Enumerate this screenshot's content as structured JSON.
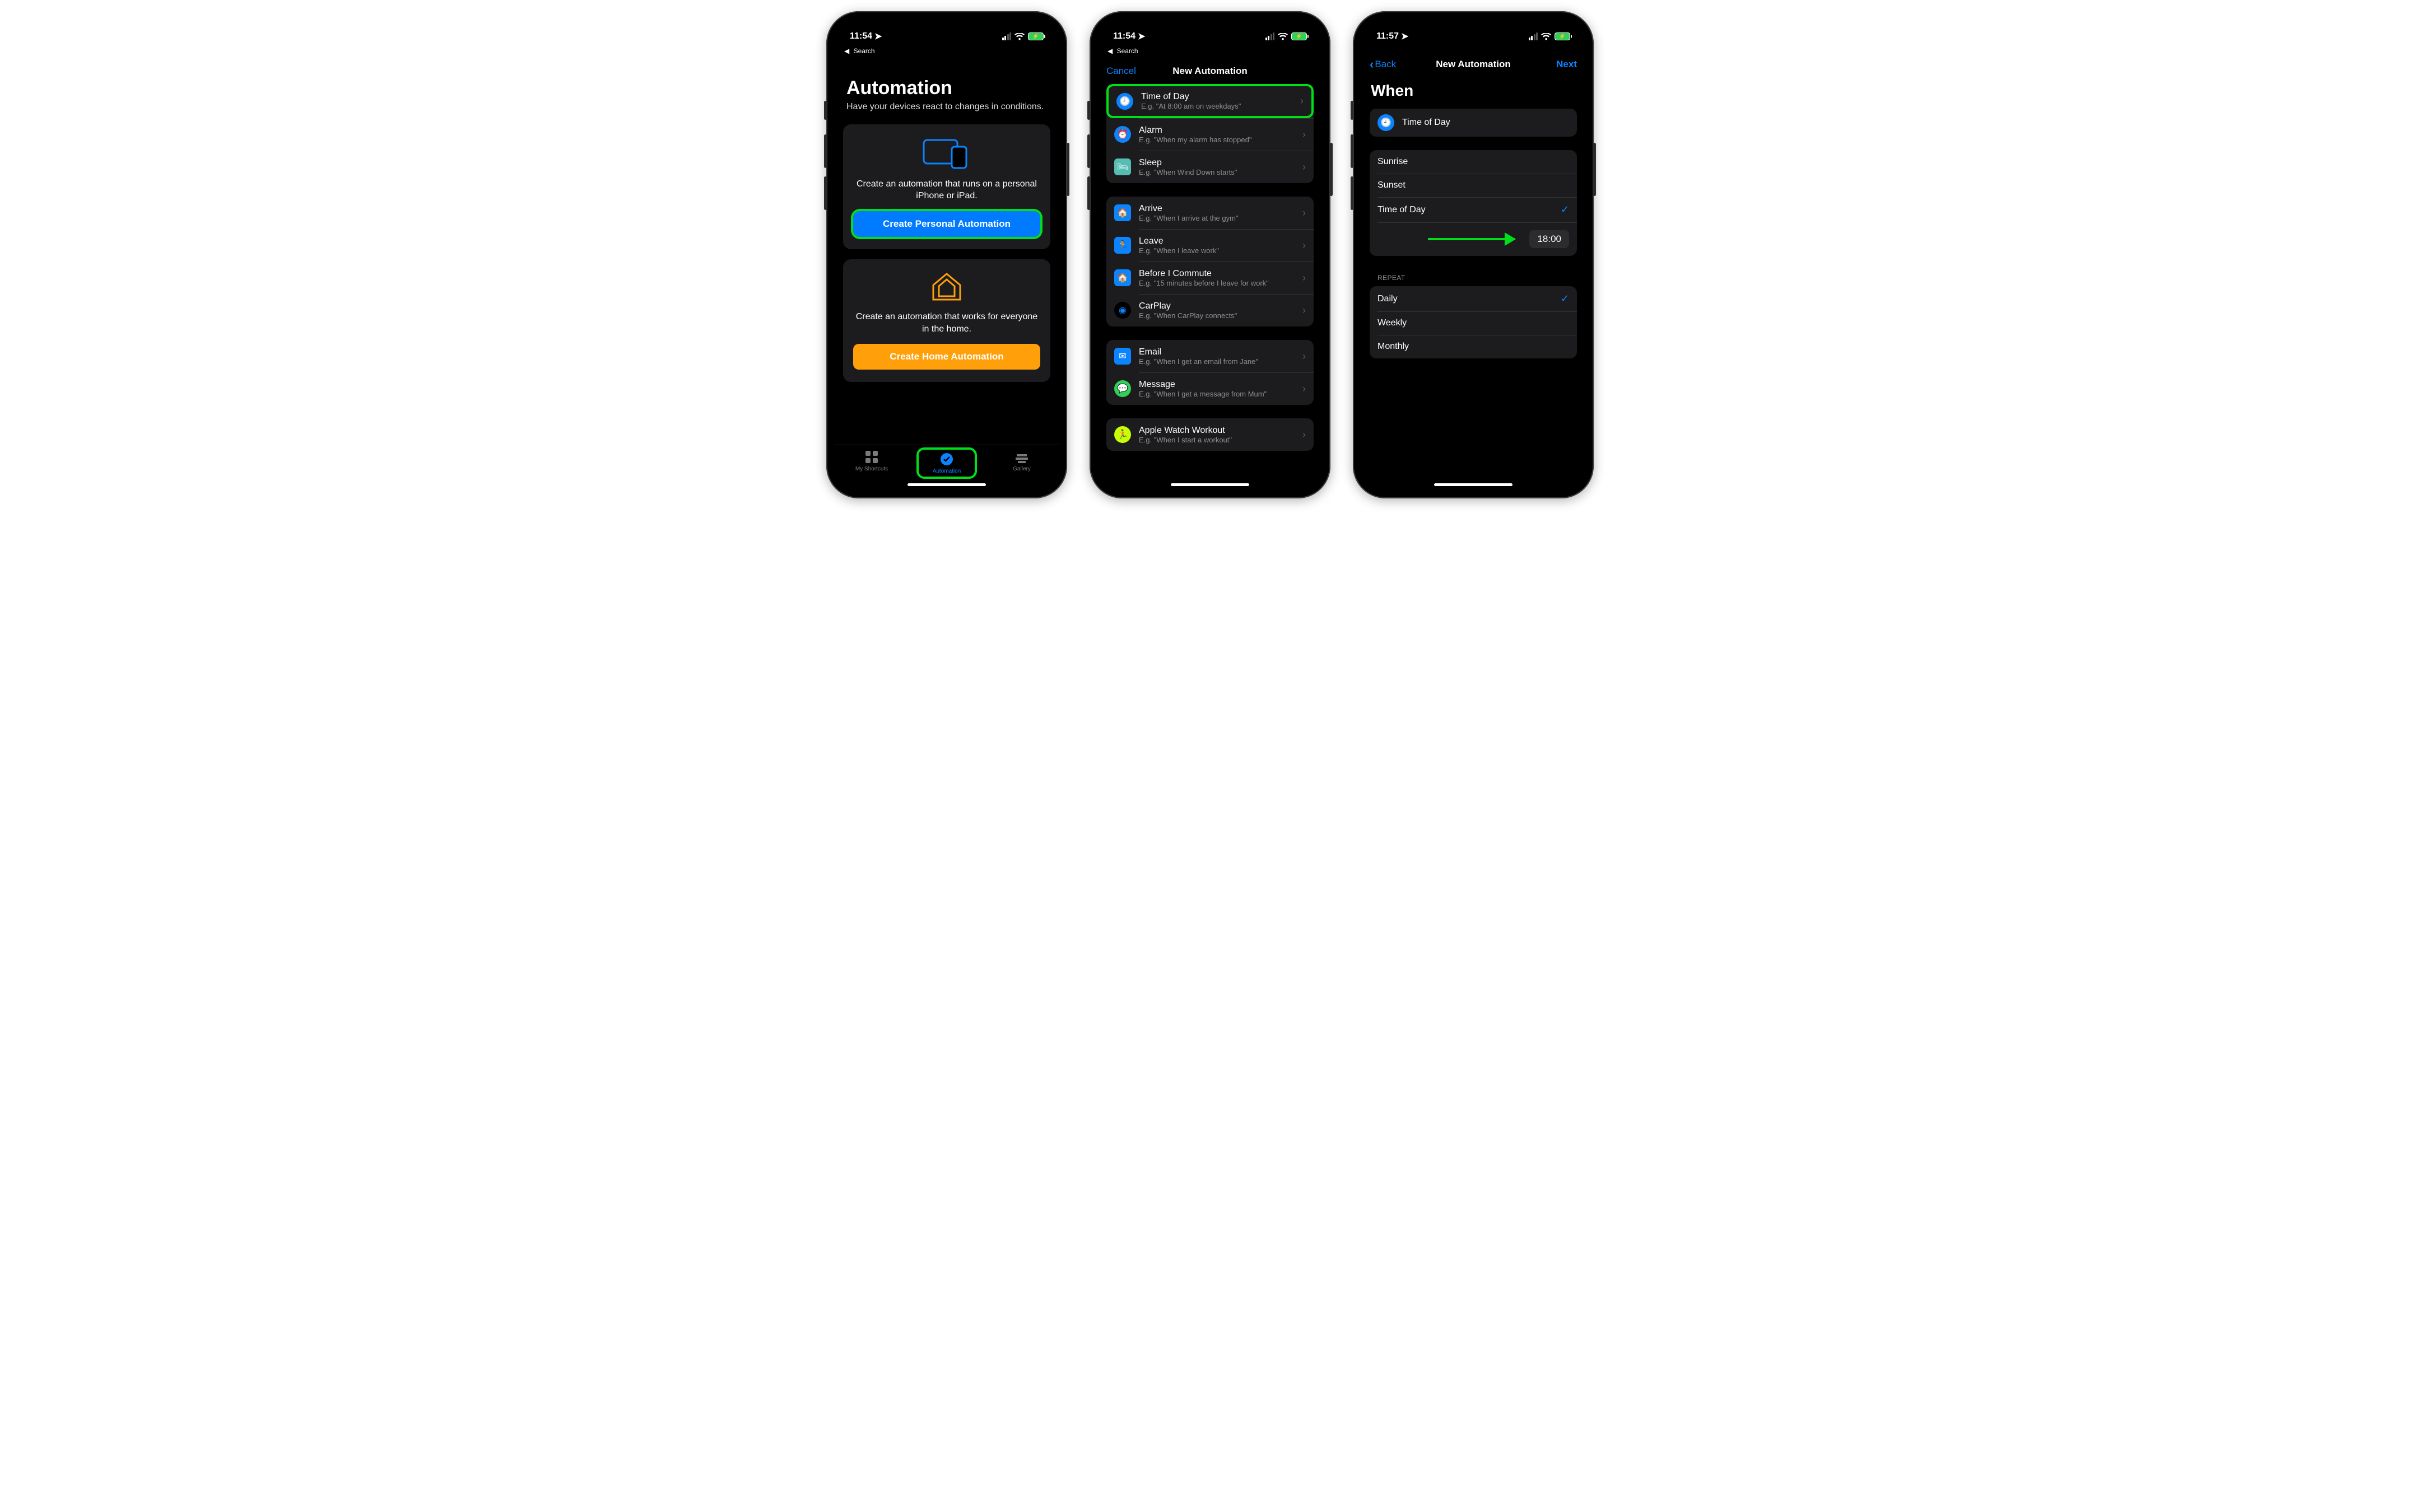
{
  "status": {
    "time1": "11:54",
    "time2": "11:54",
    "time3": "11:57",
    "breadcrumb": "Search"
  },
  "screen1": {
    "title": "Automation",
    "subtitle": "Have your devices react to changes in conditions.",
    "personal_desc": "Create an automation that runs on a personal iPhone or iPad.",
    "personal_btn": "Create Personal Automation",
    "home_desc": "Create an automation that works for everyone in the home.",
    "home_btn": "Create Home Automation",
    "tabs": {
      "shortcuts": "My Shortcuts",
      "automation": "Automation",
      "gallery": "Gallery"
    }
  },
  "screen2": {
    "cancel": "Cancel",
    "title": "New Automation",
    "groups": [
      [
        {
          "t": "Time of Day",
          "s": "E.g. \"At 8:00 am on weekdays\"",
          "ic": "clock",
          "hl": true
        },
        {
          "t": "Alarm",
          "s": "E.g. \"When my alarm has stopped\"",
          "ic": "alarm"
        },
        {
          "t": "Sleep",
          "s": "E.g. \"When Wind Down starts\"",
          "ic": "bed"
        }
      ],
      [
        {
          "t": "Arrive",
          "s": "E.g. \"When I arrive at the gym\"",
          "ic": "arrive"
        },
        {
          "t": "Leave",
          "s": "E.g. \"When I leave work\"",
          "ic": "leave"
        },
        {
          "t": "Before I Commute",
          "s": "E.g. \"15 minutes before I leave for work\"",
          "ic": "commute"
        },
        {
          "t": "CarPlay",
          "s": "E.g. \"When CarPlay connects\"",
          "ic": "carplay"
        }
      ],
      [
        {
          "t": "Email",
          "s": "E.g. \"When I get an email from Jane\"",
          "ic": "email"
        },
        {
          "t": "Message",
          "s": "E.g. \"When I get a message from Mum\"",
          "ic": "message"
        }
      ],
      [
        {
          "t": "Apple Watch Workout",
          "s": "E.g. \"When I start a workout\"",
          "ic": "workout"
        }
      ]
    ]
  },
  "screen3": {
    "back": "Back",
    "title": "New Automation",
    "next": "Next",
    "when": "When",
    "trigger": "Time of Day",
    "options": [
      {
        "t": "Sunrise",
        "chk": false
      },
      {
        "t": "Sunset",
        "chk": false
      },
      {
        "t": "Time of Day",
        "chk": true
      }
    ],
    "time_value": "18:00",
    "repeat_label": "REPEAT",
    "repeat": [
      {
        "t": "Daily",
        "chk": true
      },
      {
        "t": "Weekly",
        "chk": false
      },
      {
        "t": "Monthly",
        "chk": false
      }
    ]
  }
}
